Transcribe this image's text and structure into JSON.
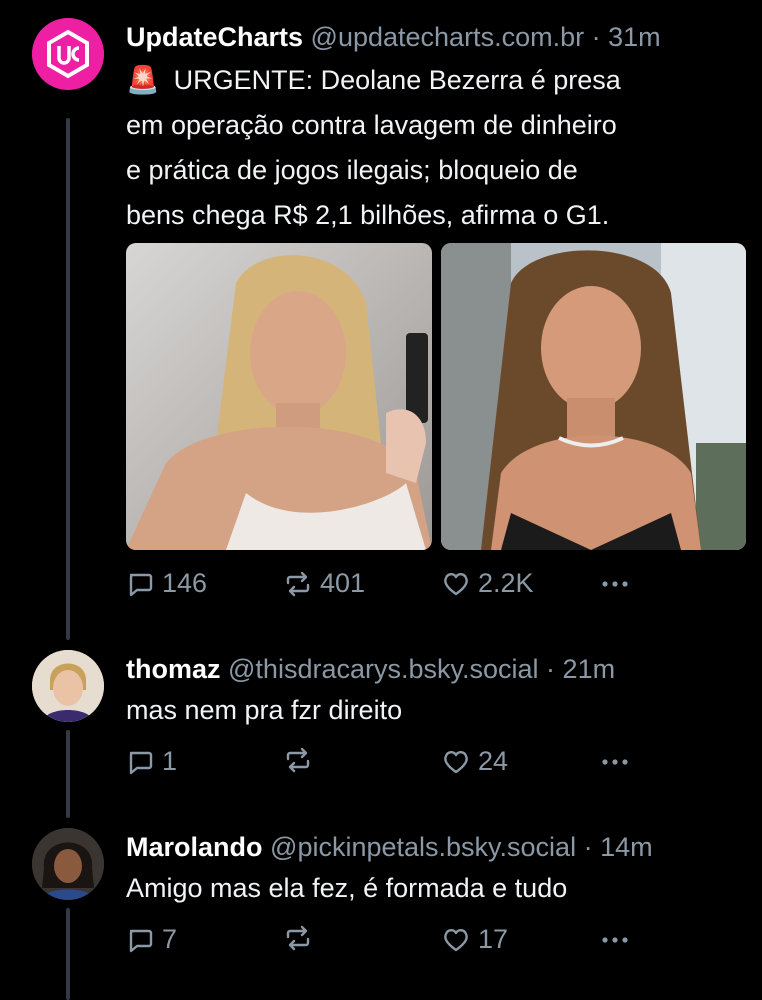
{
  "posts": [
    {
      "author": "UpdateCharts",
      "handle": "@updatecharts.com.br",
      "time": "31m",
      "text_prefix": "🚨",
      "text_lines": [
        "URGENTE: Deolane Bezerra é presa",
        "em operação contra lavagem de dinheiro",
        "e prática de jogos ilegais; bloqueio de",
        "bens chega R$ 2,1 bilhões, afirma o G1."
      ],
      "replies": "146",
      "reposts": "401",
      "likes": "2.2K"
    },
    {
      "author": "thomaz",
      "handle": "@thisdracarys.bsky.social",
      "time": "21m",
      "text": "mas nem pra fzr direito",
      "replies": "1",
      "reposts": "",
      "likes": "24"
    },
    {
      "author": "Marolando",
      "handle": "@pickinpetals.bsky.social",
      "time": "14m",
      "text": "Amigo mas ela fez, é formada e tudo",
      "replies": "7",
      "reposts": "",
      "likes": "17"
    }
  ],
  "icons": {
    "reply": "reply-icon",
    "repost": "repost-icon",
    "like": "heart-icon",
    "more": "more-icon"
  },
  "colors": {
    "background": "#000000",
    "muted": "#8b98a5",
    "thread_line": "#333a44",
    "avatar_brand": "#ee1fa3"
  }
}
